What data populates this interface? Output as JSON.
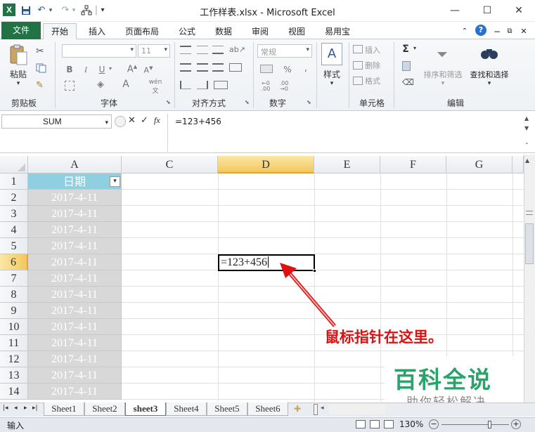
{
  "window": {
    "title": "工作样表.xlsx - Microsoft Excel",
    "quick_access": {
      "undo": "↶",
      "redo": "↷",
      "sep": "|",
      "more": "▾"
    }
  },
  "tabs": {
    "file": "文件",
    "items": [
      "开始",
      "插入",
      "页面布局",
      "公式",
      "数据",
      "审阅",
      "视图",
      "易用宝"
    ]
  },
  "ribbon": {
    "clipboard": {
      "paste": "粘贴",
      "label": "剪贴板"
    },
    "font": {
      "size": "11",
      "bold": "B",
      "italic": "I",
      "underline": "U",
      "label": "字体",
      "wen": "wén",
      "a_grow": "A",
      "a_shrink": "A"
    },
    "alignment": {
      "label": "对齐方式"
    },
    "number": {
      "format": "常规",
      "percent": "%",
      "comma": ",",
      "label": "数字"
    },
    "style": {
      "label": "样式"
    },
    "cells": {
      "insert": "插入",
      "delete": "删除",
      "format": "格式",
      "label": "单元格"
    },
    "editing": {
      "sigma": "Σ",
      "sort": "排序和筛选",
      "find": "查找和选择",
      "label": "编辑"
    }
  },
  "formula_bar": {
    "name_box": "SUM",
    "cancel": "✕",
    "enter": "✓",
    "fx": "fx",
    "formula": "=123+456"
  },
  "grid": {
    "columns": [
      "A",
      "C",
      "D",
      "E",
      "F",
      "G"
    ],
    "rows": [
      "1",
      "2",
      "3",
      "4",
      "5",
      "6",
      "7",
      "8",
      "9",
      "10",
      "11",
      "12",
      "13",
      "14"
    ],
    "a1_header": "日期",
    "a_values": [
      "2017-4-11",
      "2017-4-11",
      "2017-4-11",
      "2017-4-11",
      "2017-4-11",
      "2017-4-11",
      "2017-4-11",
      "2017-4-11",
      "2017-4-11",
      "2017-4-11",
      "2017-4-11",
      "2017-4-11",
      "2017-4-11"
    ],
    "active_cell": "D6",
    "active_cell_value": "=123+456"
  },
  "annotation": {
    "text": "鼠标指针在这里。"
  },
  "watermark": {
    "title": "百科全说",
    "subtitle": "助你轻松解决"
  },
  "sheets": [
    "Sheet1",
    "Sheet2",
    "sheet3",
    "Sheet4",
    "Sheet5",
    "Sheet6"
  ],
  "active_sheet": "sheet3",
  "status": {
    "mode": "输入",
    "zoom": "130%"
  },
  "colors": {
    "accent": "#217346",
    "active_col": "#f8d26b",
    "filter_header": "#8fcfe0",
    "annotation": "#d11",
    "watermark": "#2aa36b"
  }
}
